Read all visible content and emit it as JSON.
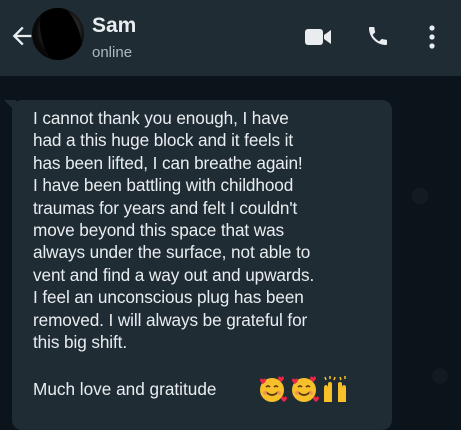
{
  "header": {
    "contact_name": "Sam",
    "status": "online",
    "icons": [
      "back-arrow-icon",
      "video-call-icon",
      "voice-call-icon",
      "more-options-icon"
    ]
  },
  "message": {
    "lines": [
      "I cannot thank you enough, I have",
      "had a this huge block and it feels it",
      "has been lifted, I can breathe again!",
      "I have been battling with childhood",
      "traumas for years and felt I couldn't",
      "move beyond this space that was",
      "always under the surface, not able to",
      "vent and find a way out and upwards.",
      "I feel an unconscious plug has been",
      "removed. I will always be grateful for",
      "this big shift."
    ],
    "closing": "Much love and gratitude",
    "emojis": [
      "smiling-face-with-hearts-icon",
      "smiling-face-with-hearts-icon",
      "raising-hands-icon"
    ]
  },
  "colors": {
    "header_bg": "#1f2c34",
    "chat_bg": "#0b141a",
    "bubble_bg": "#1f2c34",
    "text": "#e9edef",
    "status_text": "#aebac1"
  }
}
